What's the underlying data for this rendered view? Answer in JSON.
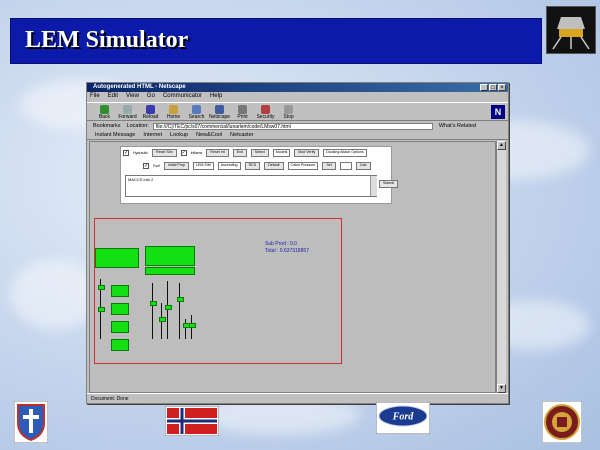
{
  "slide": {
    "title": "LEM Simulator"
  },
  "browser": {
    "window_title": "Autogenerated HTML - Netscape",
    "menu": [
      "File",
      "Edit",
      "View",
      "Go",
      "Communicator",
      "Help"
    ],
    "toolbar": [
      "Back",
      "Forward",
      "Reload",
      "Home",
      "Search",
      "Netscape",
      "Print",
      "Security",
      "Stop"
    ],
    "location_label": "Location:",
    "bookmarks_label": "Bookmarks",
    "location_url": "file:///C|/TEC/pc/s07/commercial/lunarlem/code/LMsw07.html",
    "related_label": "What's Related",
    "personal": [
      "Instant Message",
      "Internet",
      "Lookup",
      "New&Cool",
      "Netcaster"
    ],
    "status": "Document: Done"
  },
  "controls": {
    "row1": {
      "cb1_label": "Hydraulic",
      "b1": "Reset Sim",
      "cb2_label": "Inflame",
      "b2": "Reset Int",
      "b3": "Exit",
      "b4": "Select",
      "s1": "Models",
      "b5": "Mod Verify",
      "s2": "Docking Attach Options"
    },
    "row2": {
      "cb_label": "Fuel",
      "b1": "Initial Prop",
      "s1": "LEM SIM",
      "s2": "Ascending",
      "b2": "RCS",
      "b3": "Default",
      "s3": "Cabin Pressure",
      "b4": "Set",
      "b5": "Calc"
    },
    "textarea_value": "MACCS info 2",
    "submit": "Submit"
  },
  "sim": {
    "sub_prod": "Sub Prod : 0.0",
    "total": "Total : 0.637318857"
  },
  "colors": {
    "title_bar": "#0b1aa8",
    "sim_green": "#13e013",
    "sim_border": "#d03030"
  }
}
